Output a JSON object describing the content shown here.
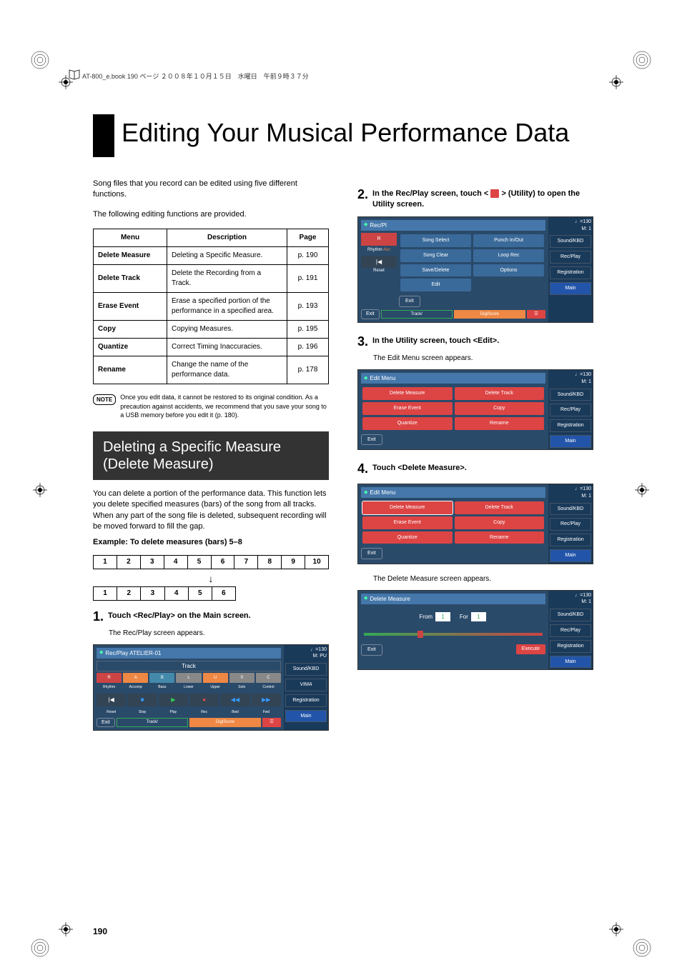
{
  "header": {
    "book_info": "AT-800_e.book 190 ページ ２００８年１０月１５日　水曜日　午前９時３７分"
  },
  "title": "Editing Your Musical Performance Data",
  "intro": {
    "p1": "Song files that you record can be edited using five different functions.",
    "p2": "The following editing functions are provided."
  },
  "table": {
    "headers": {
      "menu": "Menu",
      "desc": "Description",
      "page": "Page"
    },
    "rows": [
      {
        "menu": "Delete Measure",
        "desc": "Deleting a Specific Measure.",
        "page": "p. 190"
      },
      {
        "menu": "Delete Track",
        "desc": "Delete the Recording from a Track.",
        "page": "p. 191"
      },
      {
        "menu": "Erase Event",
        "desc": "Erase a specified portion of the performance in a specified area.",
        "page": "p. 193"
      },
      {
        "menu": "Copy",
        "desc": "Copying Measures.",
        "page": "p. 195"
      },
      {
        "menu": "Quantize",
        "desc": "Correct Timing Inaccuracies.",
        "page": "p. 196"
      },
      {
        "menu": "Rename",
        "desc": "Change the name of the performance data.",
        "page": "p. 178"
      }
    ]
  },
  "note": {
    "label": "NOTE",
    "text": "Once you edit data, it cannot be restored to its original condition. As a precaution against accidents, we recommend that you save your song to a USB memory before you edit it (p. 180)."
  },
  "section": {
    "title": "Deleting a Specific Measure (Delete Measure)",
    "desc": "You can delete a portion of the performance data. This function lets you delete specified measures (bars) of the song from all tracks. When any part of the song file is deleted, subsequent recording will be moved forward to fill the gap.",
    "example_label": "Example: To delete measures (bars) 5–8"
  },
  "diagram": {
    "row1": [
      "1",
      "2",
      "3",
      "4",
      "5",
      "6",
      "7",
      "8",
      "9",
      "10"
    ],
    "row2": [
      "1",
      "2",
      "3",
      "4",
      "5",
      "6"
    ]
  },
  "steps": {
    "s1": {
      "num": "1.",
      "text": "Touch <Rec/Play> on the Main screen.",
      "sub": "The Rec/Play screen appears."
    },
    "s2": {
      "num": "2.",
      "text_a": "In the Rec/Play screen, touch <",
      "text_b": "> (Utility) to open the Utility screen."
    },
    "s3": {
      "num": "3.",
      "text": "In the Utility screen, touch <Edit>.",
      "sub": "The Edit Menu screen appears."
    },
    "s4": {
      "num": "4.",
      "text": "Touch <Delete Measure>.",
      "sub": "The Delete Measure screen appears."
    }
  },
  "screens": {
    "tempo": "♩=130",
    "measure": "M:    1",
    "measure_pu": "M:   PU",
    "side": {
      "sound": "Sound/KBD",
      "rec": "Rec/Play",
      "reg": "Registration",
      "main": "Main",
      "vima": "VIMA"
    },
    "recplay": {
      "title": "Rec/Play    ATELIER-01",
      "track_label": "Track",
      "tracks_letter": [
        "R",
        "A",
        "B",
        "L",
        "U",
        "S",
        "C"
      ],
      "tracks": [
        "Rhythm",
        "Accomp",
        "Bass",
        "Lower",
        "Upper",
        "Solo",
        "Control"
      ],
      "transport_icons": [
        "|◀",
        "■",
        "▶",
        "●",
        "◀◀",
        "▶▶"
      ],
      "transport": [
        "Reset",
        "Stop",
        "Play",
        "Rec",
        "Bwd",
        "Fwd"
      ],
      "exit": "Exit",
      "track_btn": "Track/",
      "digi": "DigiScore"
    },
    "utility": {
      "title": "Rec/Pl",
      "items": [
        "Song Select",
        "Punch In/Out",
        "Song Clear",
        "Loop Rec",
        "Save/Delete",
        "Options",
        "Edit"
      ],
      "exit": "Exit",
      "rhythm": "Rhythm",
      "acc": "Acc",
      "reset": "Reset"
    },
    "editmenu": {
      "title": "Edit Menu",
      "items": [
        "Delete Measure",
        "Delete Track",
        "Erase Event",
        "Copy",
        "Quantize",
        "Rename"
      ],
      "exit": "Exit"
    },
    "delmeasure": {
      "title": "Delete Measure",
      "from": "From",
      "for": "For",
      "val1": "1",
      "val2": "1",
      "exit": "Exit",
      "execute": "Execute"
    }
  },
  "pagenum": "190"
}
